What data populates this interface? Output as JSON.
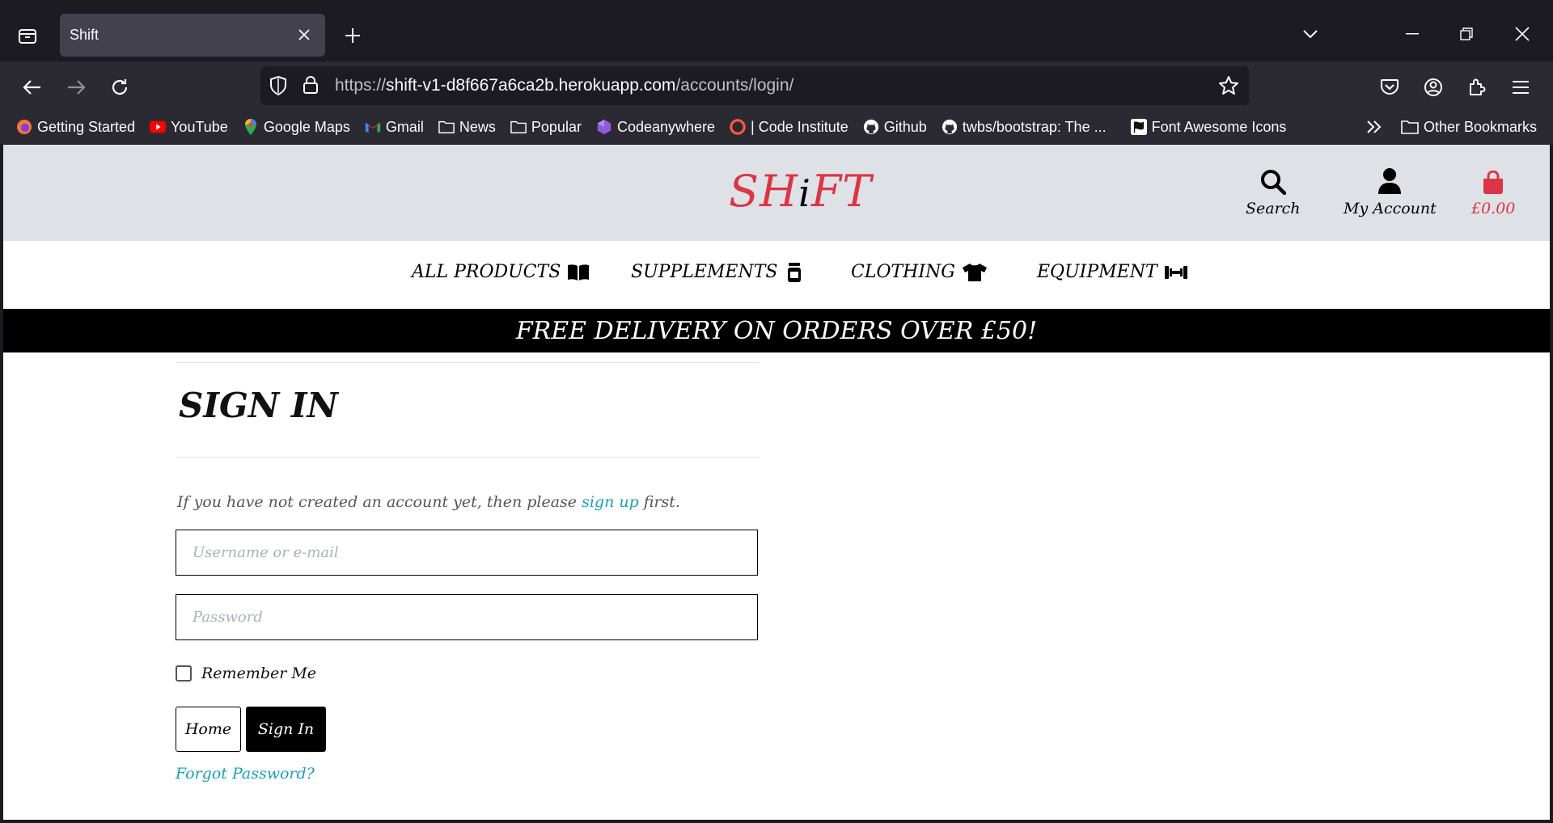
{
  "browser": {
    "tab_title": "Shift",
    "url": {
      "scheme": "https://",
      "host": "shift-v1-d8f667a6ca2b.herokuapp.com",
      "path": "/accounts/login/"
    },
    "bookmarks": [
      {
        "label": "Getting Started",
        "icon": "firefox-icon"
      },
      {
        "label": "YouTube",
        "icon": "youtube-icon"
      },
      {
        "label": "Google Maps",
        "icon": "maps-pin-icon"
      },
      {
        "label": "Gmail",
        "icon": "gmail-icon"
      },
      {
        "label": "News",
        "icon": "folder-icon"
      },
      {
        "label": "Popular",
        "icon": "folder-icon"
      },
      {
        "label": "Codeanywhere",
        "icon": "codeanywhere-icon"
      },
      {
        "label": "| Code Institute",
        "icon": "code-institute-icon"
      },
      {
        "label": "Github",
        "icon": "github-icon"
      },
      {
        "label": "twbs/bootstrap: The ...",
        "icon": "github-icon"
      },
      {
        "label": "Font Awesome Icons",
        "icon": "flag-icon"
      }
    ],
    "other_bookmarks": "Other Bookmarks"
  },
  "site": {
    "logo": {
      "part1": "SH",
      "part2": "i",
      "part3": "FT"
    },
    "header_links": {
      "search": "Search",
      "account": "My Account",
      "cart_total": "£0.00"
    },
    "nav": {
      "all_products": "ALL PRODUCTS",
      "supplements": "SUPPLEMENTS",
      "clothing": "CLOTHING",
      "equipment": "EQUIPMENT"
    },
    "banner": "FREE DELIVERY ON ORDERS OVER £50!"
  },
  "signin": {
    "title": "SIGN IN",
    "intro_before": "If you have not created an account yet, then please ",
    "intro_link": "sign up",
    "intro_after": " first.",
    "username_placeholder": "Username or e-mail",
    "password_placeholder": "Password",
    "remember_label": "Remember Me",
    "home_button": "Home",
    "signin_button": "Sign In",
    "forgot_link": "Forgot Password?"
  },
  "colors": {
    "brand_red": "#dc3545",
    "link_teal": "#17a2b8",
    "header_grey": "#dee2e6"
  }
}
